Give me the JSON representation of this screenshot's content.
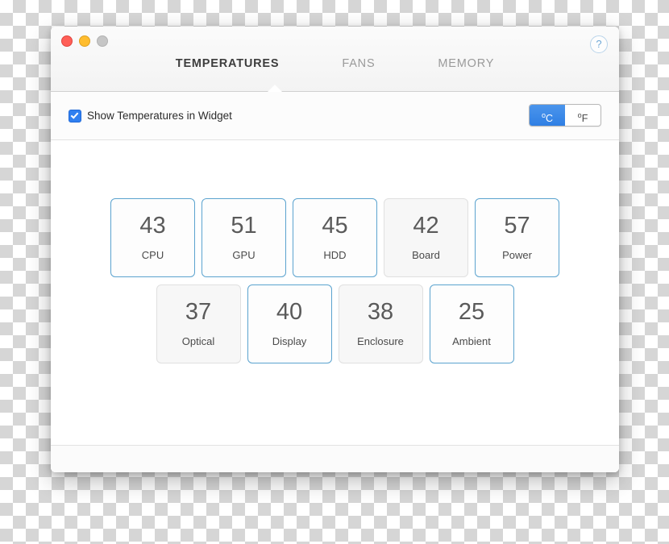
{
  "window": {
    "traffic_lights": [
      "close",
      "minimize",
      "zoom"
    ],
    "help_label": "?"
  },
  "tabs": [
    {
      "label": "TEMPERATURES",
      "active": true
    },
    {
      "label": "FANS",
      "active": false
    },
    {
      "label": "MEMORY",
      "active": false
    }
  ],
  "options": {
    "checkbox_label": "Show Temperatures in Widget",
    "checkbox_checked": true,
    "unit_segments": [
      {
        "sup": "o",
        "label": "C",
        "active": true
      },
      {
        "sup": "o",
        "label": "F",
        "active": false
      }
    ]
  },
  "sensors": {
    "row1": [
      {
        "value": "43",
        "label": "CPU",
        "highlight": true
      },
      {
        "value": "51",
        "label": "GPU",
        "highlight": true
      },
      {
        "value": "45",
        "label": "HDD",
        "highlight": true
      },
      {
        "value": "42",
        "label": "Board",
        "highlight": false
      },
      {
        "value": "57",
        "label": "Power",
        "highlight": true
      }
    ],
    "row2": [
      {
        "value": "37",
        "label": "Optical",
        "highlight": false
      },
      {
        "value": "40",
        "label": "Display",
        "highlight": true
      },
      {
        "value": "38",
        "label": "Enclosure",
        "highlight": false
      },
      {
        "value": "25",
        "label": "Ambient",
        "highlight": true
      }
    ]
  },
  "colors": {
    "accent": "#2f7fe4",
    "highlight_border": "#5ba3cf",
    "tile_bg": "#f7f7f7"
  }
}
